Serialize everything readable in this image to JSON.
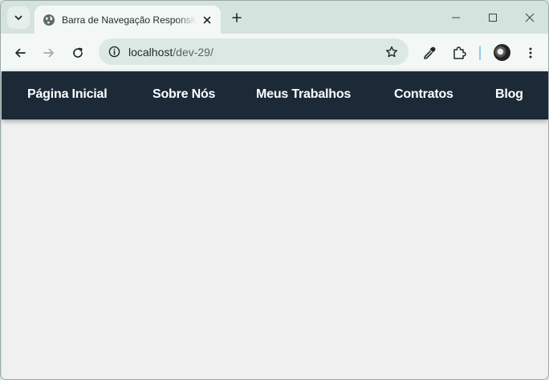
{
  "browser": {
    "tab_title": "Barra de Navegação Responsiva",
    "url_host": "localhost",
    "url_path": "/dev-29/"
  },
  "icons": {
    "tab_search": "chevron-down-icon",
    "favicon": "globe-icon",
    "tab_close": "close-icon",
    "new_tab": "plus-icon",
    "minimize": "minimize-icon",
    "maximize": "maximize-icon",
    "close_window": "close-icon",
    "back": "arrow-left-icon",
    "forward": "arrow-right-icon",
    "reload": "reload-icon",
    "site_info": "info-icon",
    "bookmark": "star-icon",
    "eyedropper": "eyedropper-icon",
    "extensions": "puzzle-icon",
    "profile": "avatar",
    "menu": "kebab-menu-icon"
  },
  "navbar": {
    "background": "#1c2a38",
    "items": [
      {
        "label": "Página Inicial"
      },
      {
        "label": "Sobre Nós"
      },
      {
        "label": "Meus Trabalhos"
      },
      {
        "label": "Contratos"
      },
      {
        "label": "Blog"
      }
    ]
  }
}
